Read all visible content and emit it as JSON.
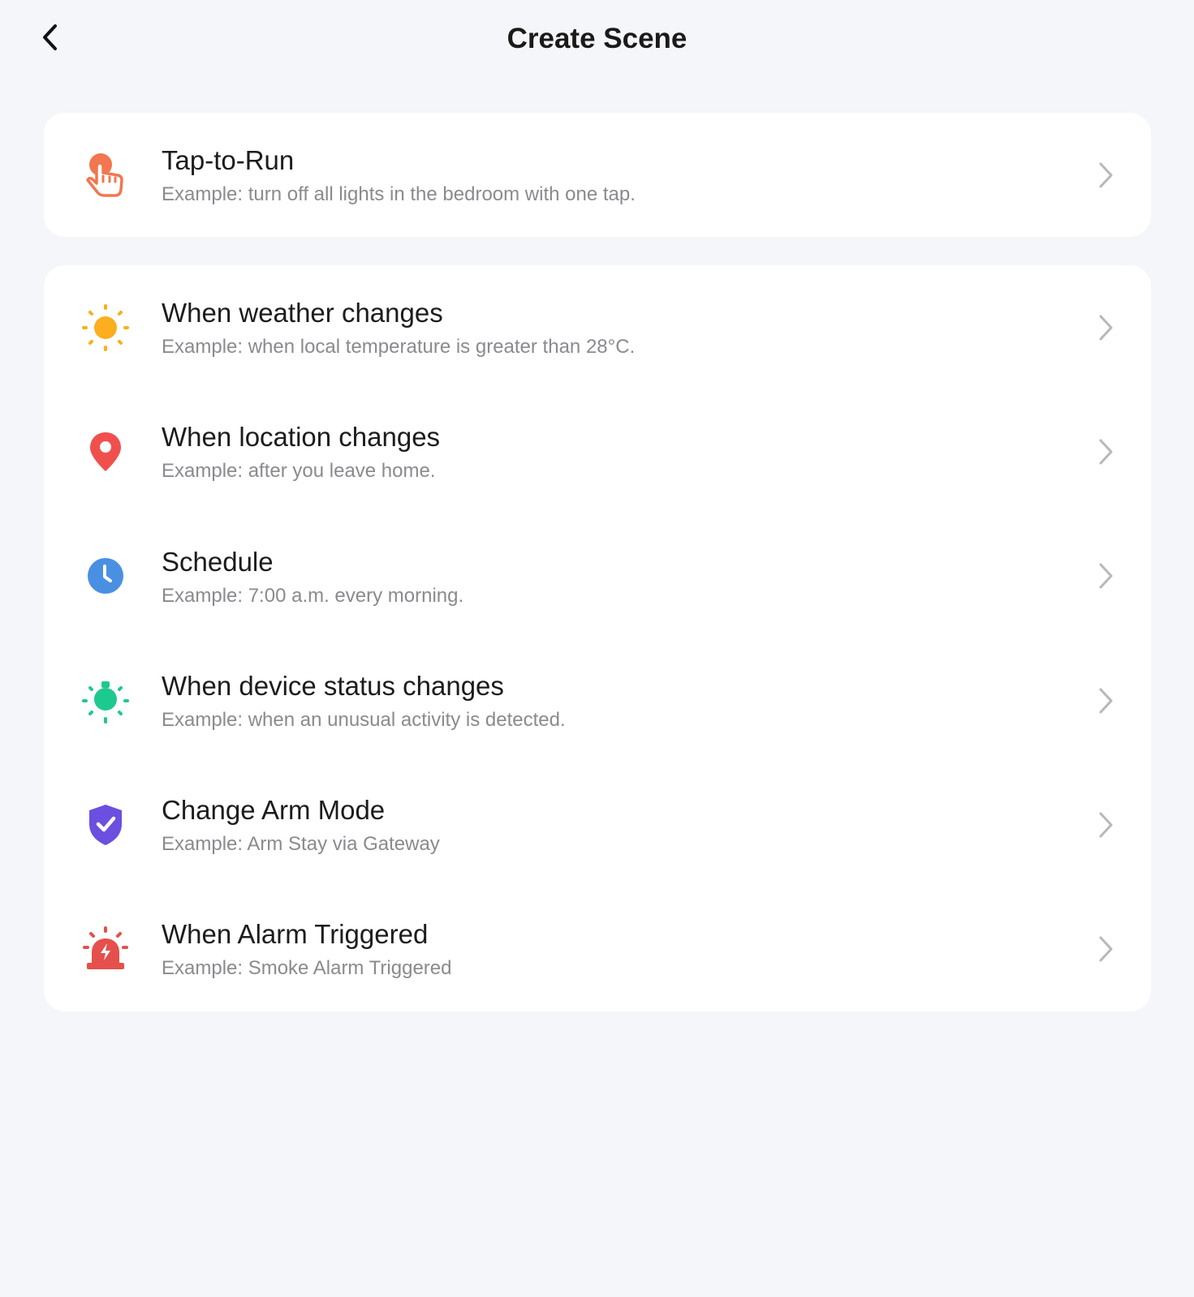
{
  "header": {
    "title": "Create Scene"
  },
  "tap_to_run": {
    "title": "Tap-to-Run",
    "subtitle": "Example: turn off all lights in the bedroom with one tap.",
    "icon": "hand-tap-icon",
    "color": "#f2764f"
  },
  "conditions": [
    {
      "title": "When weather changes",
      "subtitle": "Example: when local temperature is greater than 28°C.",
      "icon": "sun-icon",
      "color": "#fcae1e"
    },
    {
      "title": "When location changes",
      "subtitle": "Example: after you leave home.",
      "icon": "location-pin-icon",
      "color": "#f0504d"
    },
    {
      "title": "Schedule",
      "subtitle": "Example: 7:00 a.m. every morning.",
      "icon": "clock-icon",
      "color": "#4a90e2"
    },
    {
      "title": "When device status changes",
      "subtitle": "Example: when an unusual activity is detected.",
      "icon": "device-bulb-icon",
      "color": "#1dc98e"
    },
    {
      "title": "Change Arm Mode",
      "subtitle": "Example: Arm Stay via Gateway",
      "icon": "shield-check-icon",
      "color": "#6b4fe0"
    },
    {
      "title": "When Alarm Triggered",
      "subtitle": "Example: Smoke Alarm Triggered",
      "icon": "alarm-siren-icon",
      "color": "#e4504b"
    }
  ]
}
